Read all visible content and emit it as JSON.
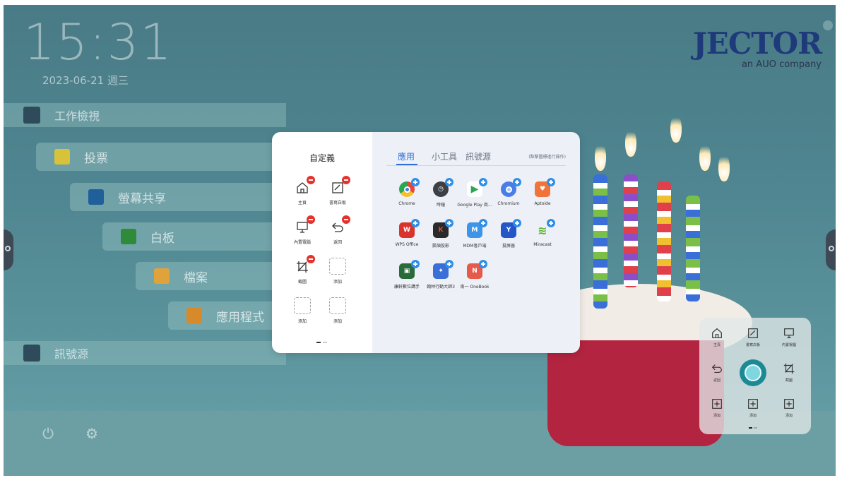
{
  "home": {
    "time": "15:31",
    "date": "2023-06-21 週三",
    "brand_logo": "JECTOR",
    "brand_sub": "an AUO company"
  },
  "menu": {
    "workspace": "工作檢視",
    "items": [
      {
        "label": "投票",
        "color": "#d8c23a"
      },
      {
        "label": "螢幕共享",
        "color": "#1f5f9a"
      },
      {
        "label": "白板",
        "color": "#2f8a3a"
      },
      {
        "label": "檔案",
        "color": "#e0a23a"
      },
      {
        "label": "應用程式",
        "color": "#d88a2a"
      }
    ],
    "source": "訊號源"
  },
  "popup": {
    "left_title": "自定義",
    "slots": [
      {
        "label": "主頁",
        "icon": "home-icon",
        "kind": "remove"
      },
      {
        "label": "書寫白板",
        "icon": "whiteboard-icon",
        "kind": "remove"
      },
      {
        "label": "內置電腦",
        "icon": "monitor-icon",
        "kind": "remove"
      },
      {
        "label": "返回",
        "icon": "back-icon",
        "kind": "remove"
      },
      {
        "label": "截圖",
        "icon": "crop-icon",
        "kind": "remove"
      },
      {
        "label": "添加",
        "icon": "empty-slot-icon",
        "kind": "add"
      },
      {
        "label": "添加",
        "icon": "empty-slot-icon",
        "kind": "add"
      },
      {
        "label": "添加",
        "icon": "empty-slot-icon",
        "kind": "add"
      }
    ],
    "tabs": {
      "apps": "應用",
      "tools": "小工具",
      "sources": "訊號源",
      "hint": "(點擊圖標進行操作)"
    },
    "apps": [
      {
        "label": "Chrome",
        "glyph": "●",
        "color": "#e8453c"
      },
      {
        "label": "時鐘",
        "glyph": "◷",
        "color": "#3c3f44"
      },
      {
        "label": "Google Play 商...",
        "glyph": "▶",
        "color": "#ffffff"
      },
      {
        "label": "Chromium",
        "glyph": "●",
        "color": "#4a7de8"
      },
      {
        "label": "Aptoide",
        "glyph": "♥",
        "color": "#f0743a"
      },
      {
        "label": "WPS Office",
        "glyph": "W",
        "color": "#d9342b"
      },
      {
        "label": "凱碩投影",
        "glyph": "K",
        "color": "#2a2a2a"
      },
      {
        "label": "MDM客戶端",
        "glyph": "M",
        "color": "#3f94e8"
      },
      {
        "label": "投屏器",
        "glyph": "Y",
        "color": "#2456c8"
      },
      {
        "label": "Miracast",
        "glyph": "≋",
        "color": "#ffffff"
      },
      {
        "label": "康軒數位講手",
        "glyph": "▣",
        "color": "#2a6b3a"
      },
      {
        "label": "翰林行動大師3",
        "glyph": "✦",
        "color": "#3a6fd8"
      },
      {
        "label": "南一 OneBook",
        "glyph": "N",
        "color": "#e65a4a"
      }
    ]
  },
  "quick_panel": {
    "items": [
      {
        "label": "主頁",
        "icon": "home-icon"
      },
      {
        "label": "書寫白板",
        "icon": "whiteboard-icon"
      },
      {
        "label": "內置電腦",
        "icon": "monitor-icon"
      },
      {
        "label": "返回",
        "icon": "back-icon"
      },
      {
        "label": "截圖",
        "icon": "crop-icon"
      },
      {
        "label": "添加",
        "icon": "add-icon"
      },
      {
        "label": "添加",
        "icon": "add-icon"
      },
      {
        "label": "添加",
        "icon": "add-icon"
      }
    ]
  }
}
